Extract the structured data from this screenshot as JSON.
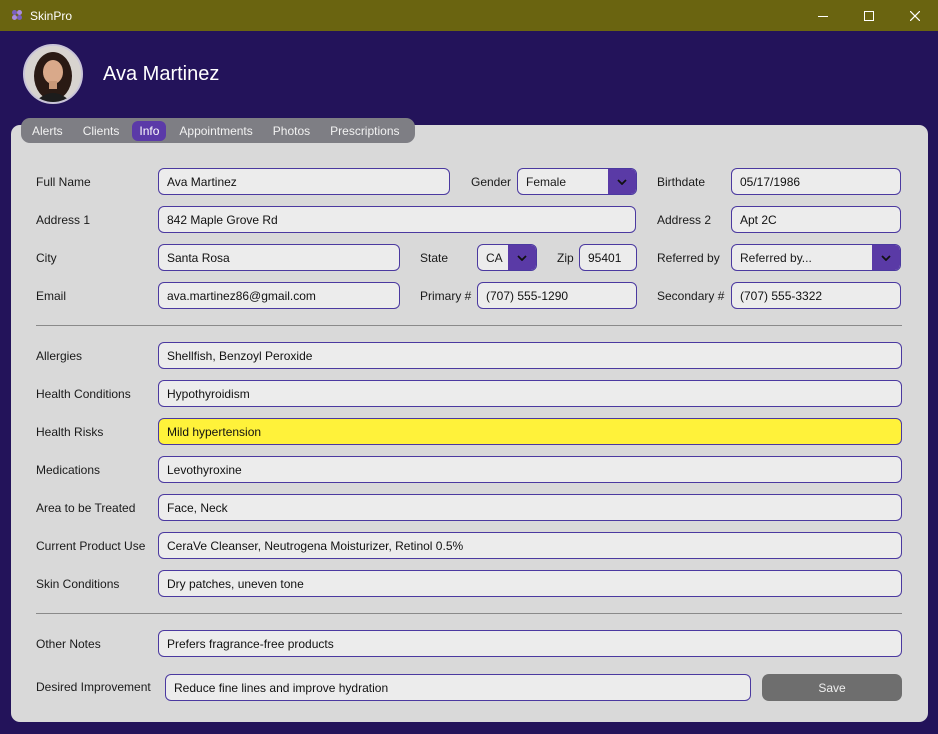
{
  "window": {
    "title": "SkinPro"
  },
  "header": {
    "client_name": "Ava Martinez"
  },
  "tabs": [
    {
      "label": "Alerts"
    },
    {
      "label": "Clients"
    },
    {
      "label": "Info",
      "active": true
    },
    {
      "label": "Appointments"
    },
    {
      "label": "Photos"
    },
    {
      "label": "Prescriptions"
    }
  ],
  "form": {
    "full_name": {
      "label": "Full Name",
      "value": "Ava Martinez"
    },
    "gender": {
      "label": "Gender",
      "value": "Female"
    },
    "birthdate": {
      "label": "Birthdate",
      "value": "05/17/1986"
    },
    "address1": {
      "label": "Address 1",
      "value": "842 Maple Grove Rd"
    },
    "address2": {
      "label": "Address 2",
      "value": "Apt 2C"
    },
    "city": {
      "label": "City",
      "value": "Santa Rosa"
    },
    "state": {
      "label": "State",
      "value": "CA"
    },
    "zip": {
      "label": "Zip",
      "value": "95401"
    },
    "referred_by": {
      "label": "Referred by",
      "value": "Referred by..."
    },
    "email": {
      "label": "Email",
      "value": "ava.martinez86@gmail.com"
    },
    "primary": {
      "label": "Primary #",
      "value": "(707) 555-1290"
    },
    "secondary": {
      "label": "Secondary #",
      "value": "(707) 555-3322"
    },
    "allergies": {
      "label": "Allergies",
      "value": "Shellfish, Benzoyl Peroxide"
    },
    "health_conditions": {
      "label": "Health Conditions",
      "value": "Hypothyroidism"
    },
    "health_risks": {
      "label": "Health Risks",
      "value": "Mild hypertension"
    },
    "medications": {
      "label": "Medications",
      "value": "Levothyroxine"
    },
    "area_treated": {
      "label": "Area to be Treated",
      "value": "Face, Neck"
    },
    "current_products": {
      "label": "Current Product Use",
      "value": "CeraVe Cleanser, Neutrogena Moisturizer, Retinol 0.5%"
    },
    "skin_conditions": {
      "label": "Skin Conditions",
      "value": "Dry patches, uneven tone"
    },
    "other_notes": {
      "label": "Other Notes",
      "value": "Prefers fragrance-free products"
    },
    "desired_improvement": {
      "label": "Desired Improvement",
      "value": "Reduce fine lines and improve hydration"
    }
  },
  "actions": {
    "save_label": "Save"
  },
  "colors": {
    "accent": "#5a3aa6",
    "titlebar": "#6a6410",
    "background": "#23135a",
    "highlight": "#fff23a"
  }
}
